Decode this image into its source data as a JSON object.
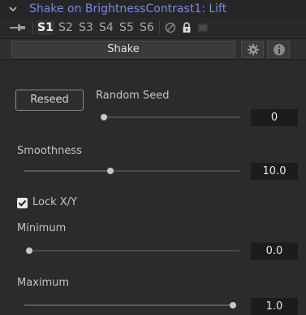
{
  "header": {
    "title": "Shake on BrightnessContrast1: Lift",
    "title_color": "#7b87e0"
  },
  "versions": {
    "items": [
      "S1",
      "S2",
      "S3",
      "S4",
      "S5",
      "S6"
    ],
    "active": "S1"
  },
  "tabs": {
    "shake_label": "Shake",
    "icons": [
      "gear-icon",
      "info-icon"
    ]
  },
  "reseed": {
    "button_label": "Reseed"
  },
  "random_seed": {
    "label": "Random Seed",
    "value": "0",
    "fraction": 0.0
  },
  "smoothness": {
    "label": "Smoothness",
    "value": "10.0",
    "fraction": 0.4
  },
  "lock_xy": {
    "label": "Lock X/Y",
    "checked": true
  },
  "minimum": {
    "label": "Minimum",
    "value": "0.0",
    "fraction": 0.0
  },
  "maximum": {
    "label": "Maximum",
    "value": "1.0",
    "fraction": 1.0
  }
}
